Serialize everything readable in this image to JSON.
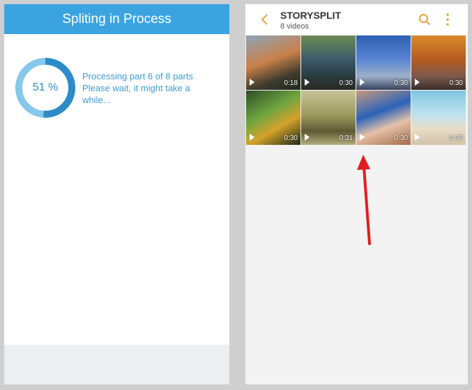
{
  "left": {
    "title": "Spliting in Process",
    "progress_percent": 51,
    "progress_label": "51 %",
    "status_line1": "Processing part 6 of 8 parts",
    "status_line2": "Please wait, it might take a",
    "status_line3": "while..."
  },
  "right": {
    "album_title": "STORYSPLIT",
    "album_subtitle": "8 videos",
    "icons": {
      "back": "back-chevron-icon",
      "search": "search-icon",
      "more": "more-vertical-icon"
    },
    "videos": [
      {
        "duration": "0:18"
      },
      {
        "duration": "0:30"
      },
      {
        "duration": "0:30"
      },
      {
        "duration": "0:30"
      },
      {
        "duration": "0:30"
      },
      {
        "duration": "0:31"
      },
      {
        "duration": "0:30"
      },
      {
        "duration": "0:30"
      }
    ]
  },
  "colors": {
    "header_blue": "#3ba4e0",
    "ring_dark": "#2d8cc8",
    "ring_light": "#86c8ec",
    "accent_orange": "#e8a33d",
    "annotation_arrow": "#e21d1d"
  }
}
